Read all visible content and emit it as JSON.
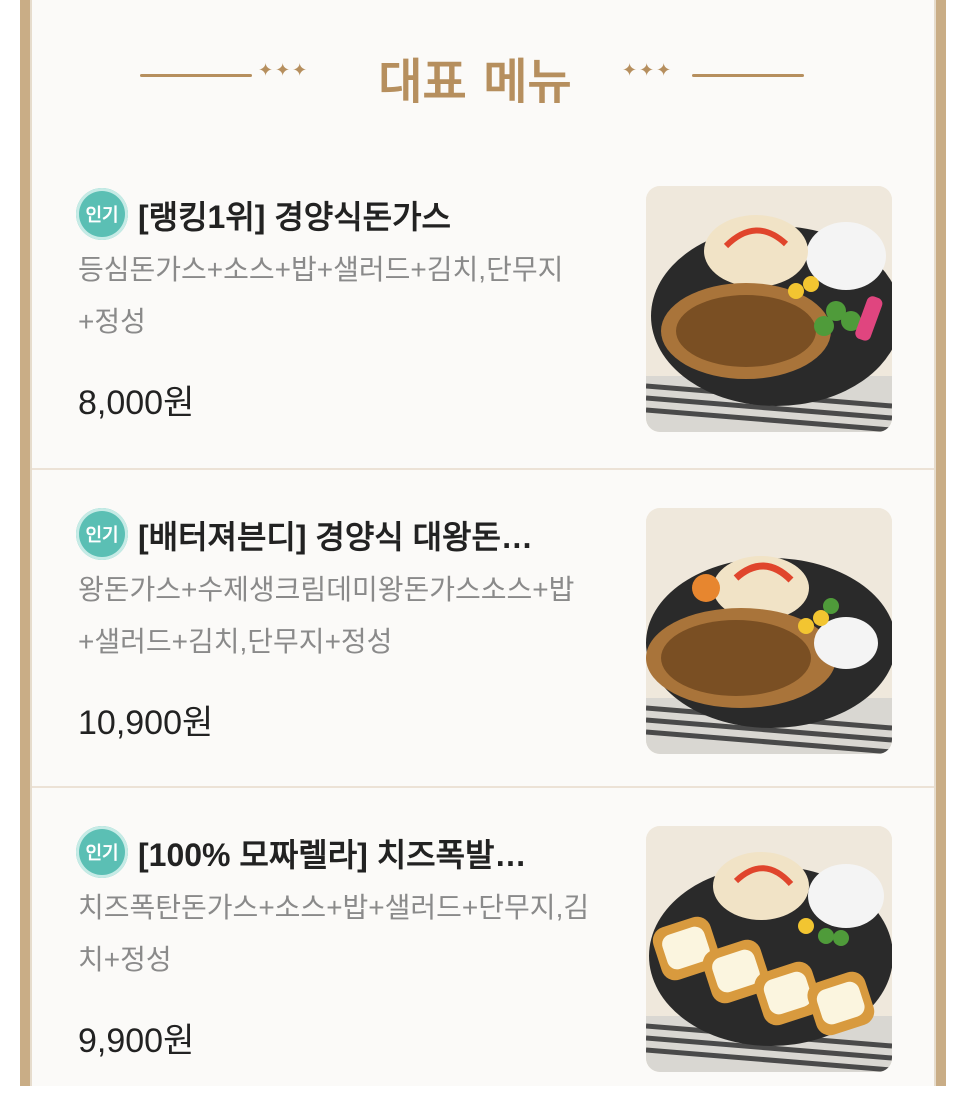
{
  "header": {
    "title": "대표 메뉴"
  },
  "badge_label": "인기",
  "items": [
    {
      "name": "[랭킹1위] 경양식돈가스",
      "desc": "등심돈가스+소스+밥+샐러드+김치,단무지+정성",
      "price": "8,000원"
    },
    {
      "name": "[배터져븐디] 경양식 대왕돈…",
      "desc": "왕돈가스+수제생크림데미왕돈가스소스+밥+샐러드+김치,단무지+정성",
      "price": "10,900원"
    },
    {
      "name": "[100% 모짜렐라] 치즈폭발…",
      "desc": "치즈폭탄돈가스+소스+밥+샐러드+단무지,김치+정성",
      "price": "9,900원"
    }
  ],
  "colors": {
    "accent": "#b68f5e",
    "badge": "#5bbfb4"
  }
}
